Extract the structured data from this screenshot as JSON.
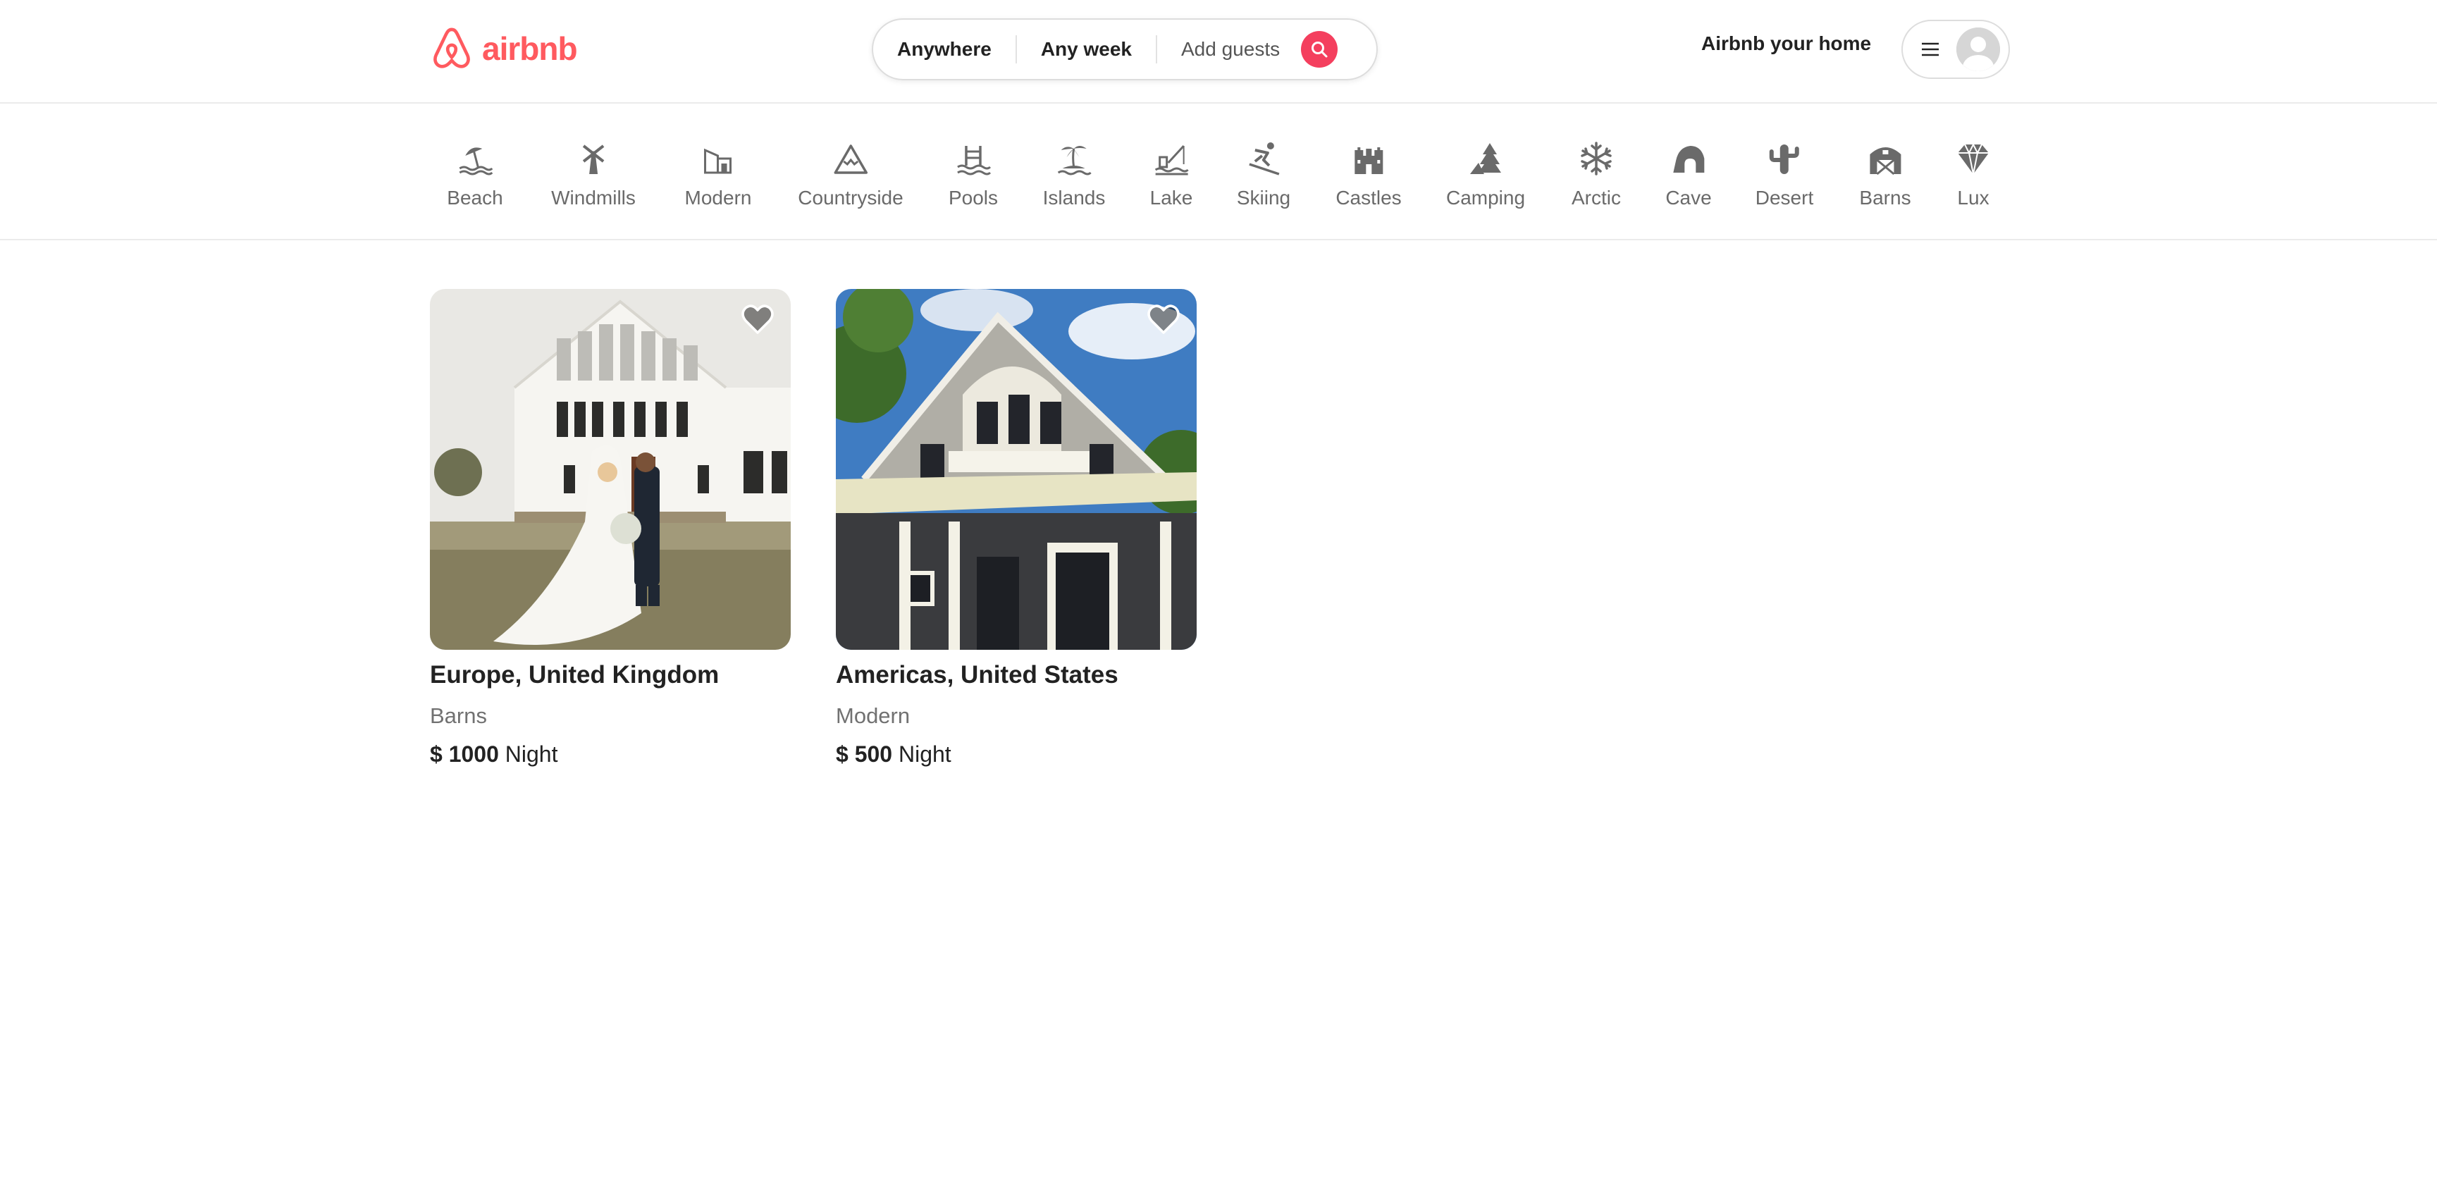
{
  "header": {
    "logo_text": "airbnb",
    "brand_color": "#ff5a5f",
    "search": {
      "location": "Anywhere",
      "week": "Any week",
      "guests": "Add guests",
      "button_color": "#f43f5e"
    },
    "host_link": "Airbnb your home"
  },
  "categories": [
    {
      "label": "Beach",
      "icon": "beach-icon"
    },
    {
      "label": "Windmills",
      "icon": "windmill-icon"
    },
    {
      "label": "Modern",
      "icon": "modern-house-icon"
    },
    {
      "label": "Countryside",
      "icon": "mountain-icon"
    },
    {
      "label": "Pools",
      "icon": "pool-icon"
    },
    {
      "label": "Islands",
      "icon": "island-icon"
    },
    {
      "label": "Lake",
      "icon": "lake-icon"
    },
    {
      "label": "Skiing",
      "icon": "skiing-icon"
    },
    {
      "label": "Castles",
      "icon": "castle-icon"
    },
    {
      "label": "Camping",
      "icon": "camping-icon"
    },
    {
      "label": "Arctic",
      "icon": "snowflake-icon"
    },
    {
      "label": "Cave",
      "icon": "cave-icon"
    },
    {
      "label": "Desert",
      "icon": "cactus-icon"
    },
    {
      "label": "Barns",
      "icon": "barn-icon"
    },
    {
      "label": "Lux",
      "icon": "diamond-icon"
    }
  ],
  "listings": [
    {
      "location": "Europe, United Kingdom",
      "category": "Barns",
      "currency": "$",
      "price": "1000",
      "unit": "Night"
    },
    {
      "location": "Americas, United States",
      "category": "Modern",
      "currency": "$",
      "price": "500",
      "unit": "Night"
    }
  ]
}
